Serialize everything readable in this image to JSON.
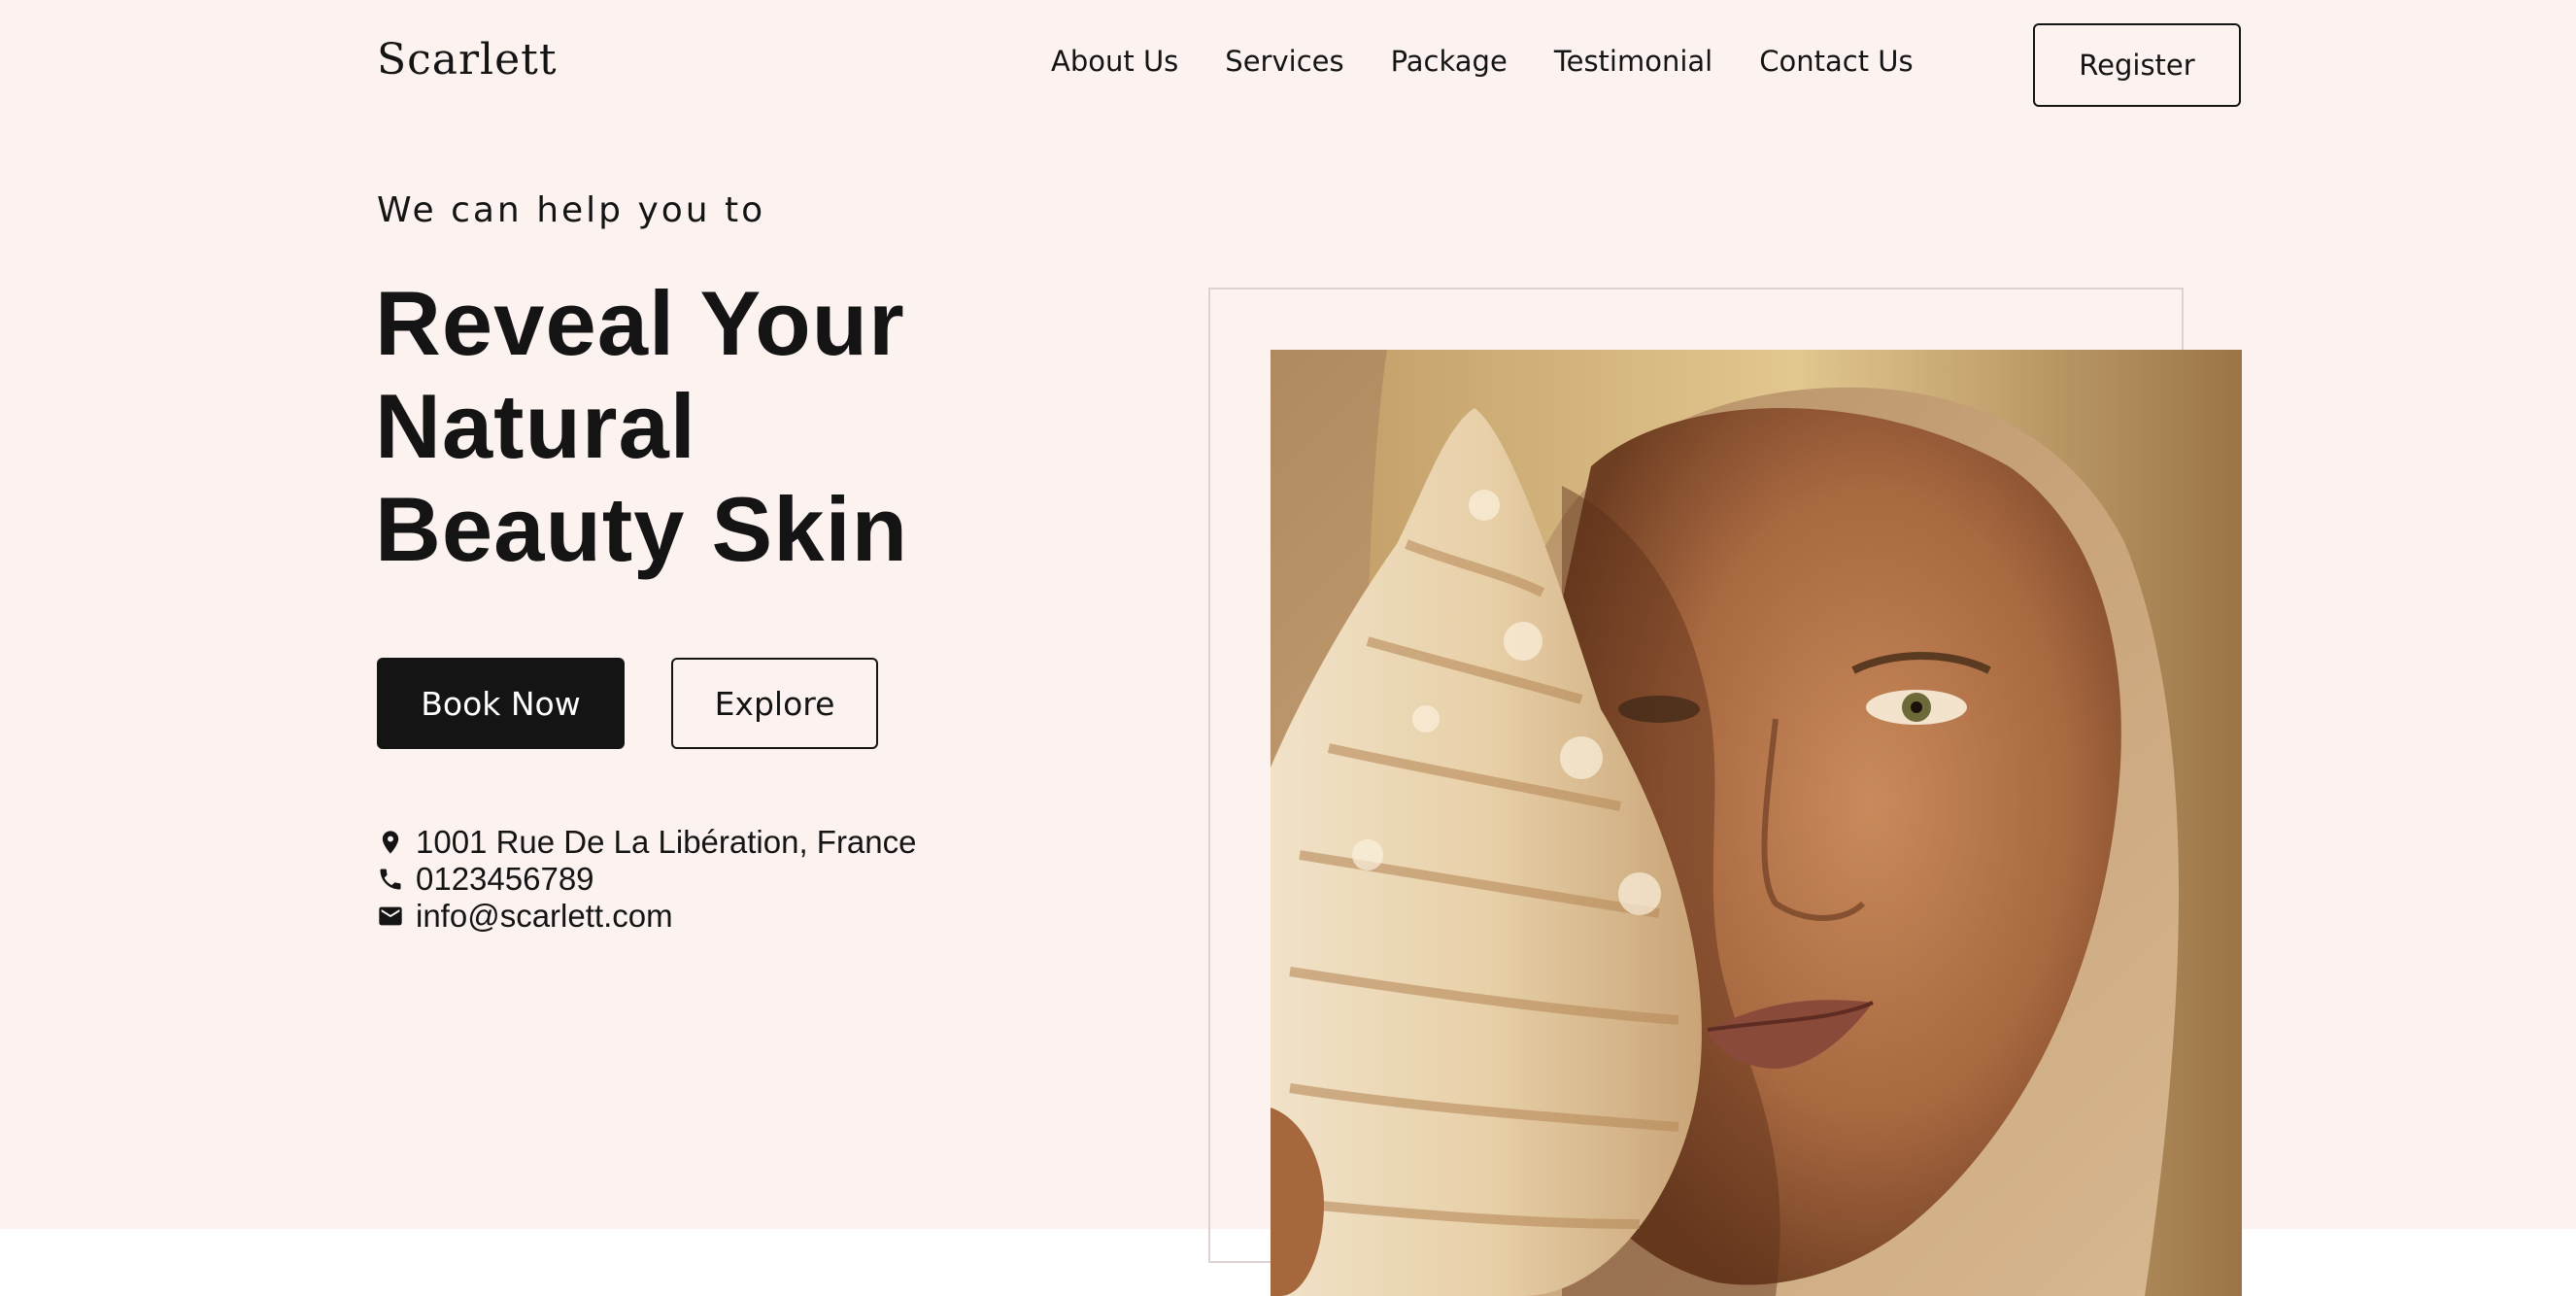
{
  "brand": {
    "name": "Scarlett"
  },
  "nav": {
    "items": [
      {
        "label": "About Us"
      },
      {
        "label": "Services"
      },
      {
        "label": "Package"
      },
      {
        "label": "Testimonial"
      },
      {
        "label": "Contact Us"
      }
    ],
    "register_label": "Register"
  },
  "hero": {
    "eyebrow": "We can help you to",
    "headline_lines": [
      "Reveal Your",
      "Natural",
      "Beauty Skin"
    ],
    "book_label": "Book Now",
    "explore_label": "Explore",
    "contact": {
      "address": "1001 Rue De La Libération, France",
      "phone": "0123456789",
      "email": "info@scarlett.com"
    }
  },
  "colors": {
    "hero_background": "#fcf3f1",
    "primary": "#141414",
    "frame_border": "#ddd2cf"
  },
  "icons": [
    "map-pin-icon",
    "phone-icon",
    "mail-icon"
  ]
}
